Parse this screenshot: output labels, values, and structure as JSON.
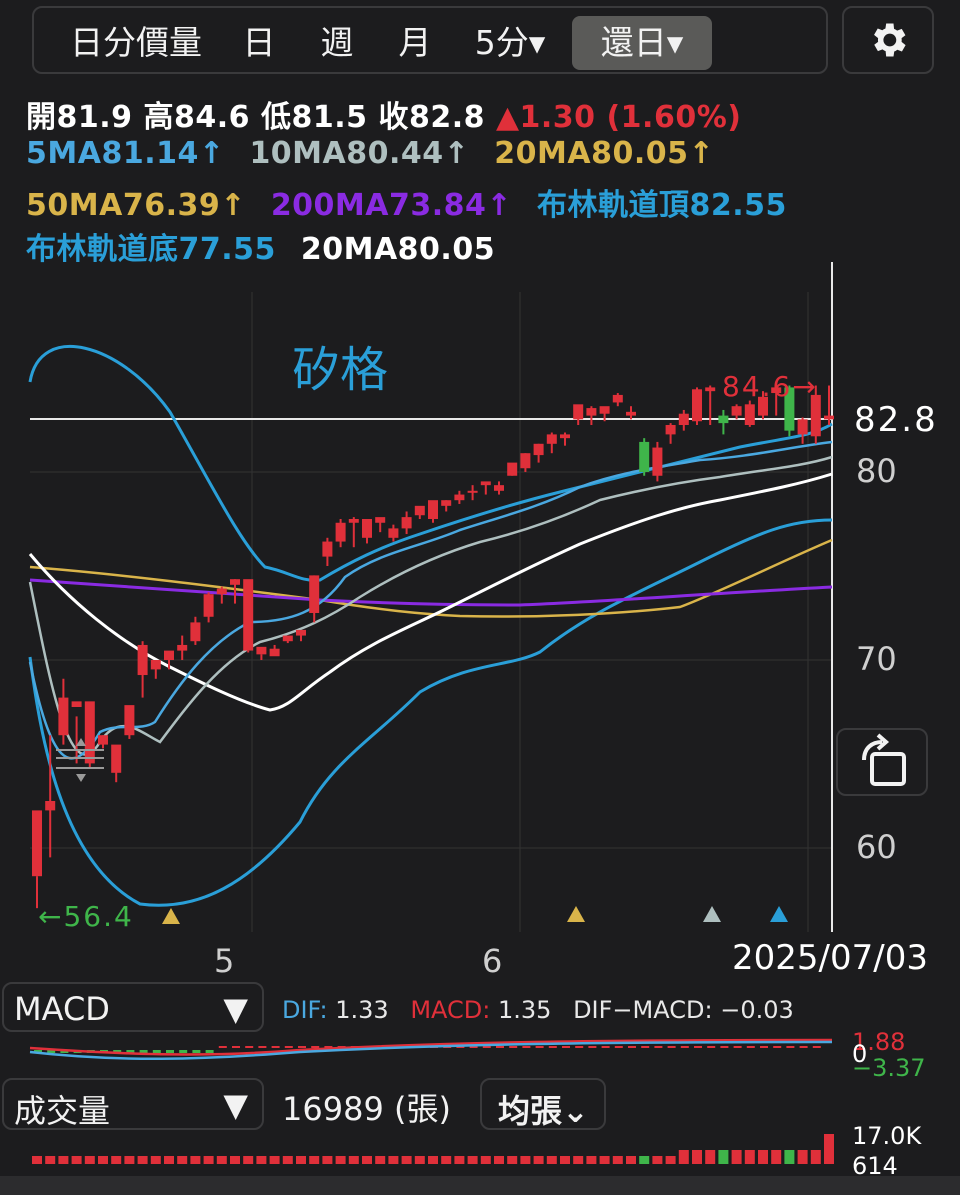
{
  "tabs": [
    {
      "label": "日分價量"
    },
    {
      "label": "日"
    },
    {
      "label": "週"
    },
    {
      "label": "月"
    },
    {
      "label": "5分▾"
    },
    {
      "label": "還日▾"
    }
  ],
  "active_tab": "還日▾",
  "settings_icon": "gear-icon",
  "quote": {
    "open_label": "開",
    "open": "81.9",
    "high_label": "高",
    "high": "84.6",
    "low_label": "低",
    "low": "81.5",
    "close_label": "收",
    "close": "82.8",
    "change": "▲1.30 (1.60%)"
  },
  "indicators": {
    "ma5": "5MA81.14↑",
    "ma10": "10MA80.44↑",
    "ma20": "20MA80.05↑",
    "ma50": "50MA76.39↑",
    "ma200": "200MA73.84↑",
    "boll_top": "布林軌道頂82.55",
    "boll_bottom": "布林軌道底77.55",
    "boll_mid": "20MA80.05"
  },
  "colors": {
    "up": "#e0303a",
    "down": "#3fb54a",
    "ma5": "#4aa8e0",
    "ma10": "#aebfbf",
    "ma20": "#d9b44a",
    "ma50": "#d9b44a",
    "ma200": "#8a2be2",
    "boll": "#2a9fd8",
    "mid": "#ffffff"
  },
  "stock_name": "矽格",
  "price_axis": {
    "labels": [
      "80",
      "70",
      "60"
    ],
    "last_price": "82.8",
    "high_marker": "84.6→",
    "low_marker": "←56.4"
  },
  "time_axis": {
    "labels": [
      "5",
      "6"
    ],
    "date": "2025/07/03"
  },
  "macd": {
    "selector": "MACD",
    "dif_label": "DIF:",
    "dif": "1.33",
    "macd_label": "MACD:",
    "macd": "1.35",
    "diff_label": "DIF−MACD:",
    "diff": "−0.03",
    "axis_top": "1.88",
    "axis_mid": "0",
    "axis_bottom": "−3.37"
  },
  "volume": {
    "selector": "成交量",
    "value": "16989 (張)",
    "unit_button": "均張⌄",
    "axis_top": "17.0K",
    "axis_bottom": "614"
  },
  "chart_data": {
    "type": "candlestick",
    "ylim": [
      56,
      88
    ],
    "candles": [
      [
        58.5,
        62.0,
        58.5,
        56.8
      ],
      [
        62.0,
        62.5,
        59.5,
        66.0
      ],
      [
        66.0,
        68.0,
        65.5,
        69.0
      ],
      [
        67.5,
        67.8,
        64.5,
        67.0
      ],
      [
        64.5,
        67.8,
        64.3,
        66.0
      ],
      [
        65.5,
        66.0,
        65.3,
        66.0
      ],
      [
        64.0,
        65.5,
        63.5,
        65.0
      ],
      [
        66.0,
        67.6,
        65.8,
        66.2
      ],
      [
        69.2,
        70.8,
        68.0,
        71.0
      ],
      [
        69.5,
        70.0,
        69.0,
        69.8
      ],
      [
        70.0,
        70.5,
        69.5,
        70.0
      ],
      [
        70.5,
        70.8,
        70.0,
        71.3
      ],
      [
        71.0,
        72.0,
        70.8,
        72.3
      ],
      [
        72.3,
        73.5,
        72.0,
        73.6
      ],
      [
        73.5,
        73.8,
        73.0,
        73.9
      ],
      [
        74.0,
        74.3,
        73.0,
        74.3
      ],
      [
        70.5,
        74.3,
        70.5,
        70.4
      ],
      [
        70.3,
        70.7,
        70.0,
        70.3
      ],
      [
        70.2,
        70.6,
        70.5,
        70.8
      ],
      [
        71.0,
        71.3,
        70.9,
        71.1
      ],
      [
        71.3,
        71.6,
        71.0,
        71.4
      ],
      [
        72.5,
        74.5,
        72.0,
        74.5
      ],
      [
        75.5,
        76.3,
        75.0,
        76.5
      ],
      [
        76.3,
        77.3,
        76.0,
        77.5
      ],
      [
        77.3,
        77.5,
        76.0,
        77.6
      ],
      [
        76.5,
        77.5,
        76.2,
        77.5
      ],
      [
        77.3,
        77.6,
        76.8,
        77.5
      ],
      [
        76.5,
        77.0,
        76.3,
        77.2
      ],
      [
        77.0,
        77.6,
        76.7,
        77.9
      ],
      [
        77.7,
        78.2,
        77.5,
        78.0
      ],
      [
        77.5,
        78.5,
        77.3,
        78.4
      ],
      [
        78.2,
        78.5,
        77.9,
        78.5
      ],
      [
        78.5,
        78.8,
        78.3,
        79.0
      ],
      [
        78.9,
        79.0,
        78.5,
        79.3
      ],
      [
        79.3,
        79.5,
        78.8,
        79.4
      ],
      [
        79.0,
        79.3,
        78.8,
        79.5
      ],
      [
        79.8,
        80.5,
        79.8,
        80.4
      ],
      [
        80.2,
        81.0,
        80.0,
        81.0
      ],
      [
        80.9,
        81.5,
        80.5,
        81.5
      ],
      [
        81.5,
        82.0,
        81.0,
        82.1
      ],
      [
        81.8,
        82.0,
        81.4,
        82.1
      ],
      [
        82.8,
        83.6,
        82.5,
        83.5
      ],
      [
        83.0,
        83.4,
        82.5,
        83.5
      ],
      [
        83.1,
        83.5,
        82.7,
        83.4
      ],
      [
        83.7,
        84.1,
        83.5,
        84.2
      ],
      [
        83.0,
        83.2,
        82.8,
        83.5
      ],
      [
        81.6,
        80.0,
        79.8,
        81.8
      ],
      [
        79.8,
        81.3,
        79.5,
        81.6
      ],
      [
        82.0,
        82.5,
        81.5,
        82.6
      ],
      [
        82.5,
        83.1,
        82.2,
        83.3
      ],
      [
        82.7,
        84.4,
        82.5,
        84.5
      ],
      [
        84.3,
        84.5,
        82.5,
        84.6
      ],
      [
        83.0,
        82.6,
        82.0,
        83.3
      ],
      [
        83.0,
        83.5,
        82.8,
        83.6
      ],
      [
        82.5,
        83.6,
        82.4,
        83.8
      ],
      [
        83.0,
        84.0,
        82.8,
        84.3
      ],
      [
        84.2,
        84.5,
        83.0,
        84.6
      ],
      [
        84.5,
        82.2,
        81.9,
        84.6
      ],
      [
        82.0,
        82.8,
        81.5,
        82.9
      ],
      [
        81.9,
        84.1,
        81.5,
        84.6
      ],
      [
        82.8,
        83.0,
        82.5,
        84.6
      ]
    ]
  }
}
